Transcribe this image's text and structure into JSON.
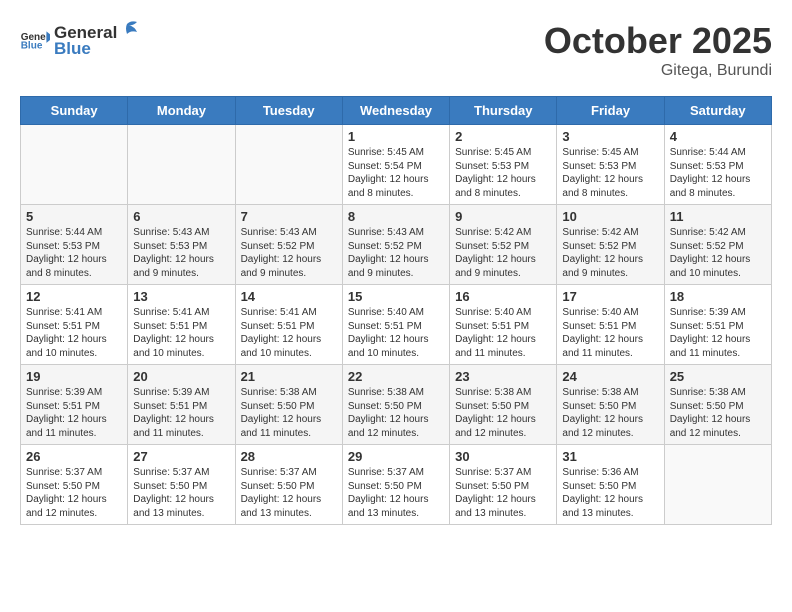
{
  "header": {
    "logo_general": "General",
    "logo_blue": "Blue",
    "month": "October 2025",
    "location": "Gitega, Burundi"
  },
  "days_of_week": [
    "Sunday",
    "Monday",
    "Tuesday",
    "Wednesday",
    "Thursday",
    "Friday",
    "Saturday"
  ],
  "weeks": [
    [
      {
        "day": "",
        "info": ""
      },
      {
        "day": "",
        "info": ""
      },
      {
        "day": "",
        "info": ""
      },
      {
        "day": "1",
        "info": "Sunrise: 5:45 AM\nSunset: 5:54 PM\nDaylight: 12 hours\nand 8 minutes."
      },
      {
        "day": "2",
        "info": "Sunrise: 5:45 AM\nSunset: 5:53 PM\nDaylight: 12 hours\nand 8 minutes."
      },
      {
        "day": "3",
        "info": "Sunrise: 5:45 AM\nSunset: 5:53 PM\nDaylight: 12 hours\nand 8 minutes."
      },
      {
        "day": "4",
        "info": "Sunrise: 5:44 AM\nSunset: 5:53 PM\nDaylight: 12 hours\nand 8 minutes."
      }
    ],
    [
      {
        "day": "5",
        "info": "Sunrise: 5:44 AM\nSunset: 5:53 PM\nDaylight: 12 hours\nand 8 minutes."
      },
      {
        "day": "6",
        "info": "Sunrise: 5:43 AM\nSunset: 5:53 PM\nDaylight: 12 hours\nand 9 minutes."
      },
      {
        "day": "7",
        "info": "Sunrise: 5:43 AM\nSunset: 5:52 PM\nDaylight: 12 hours\nand 9 minutes."
      },
      {
        "day": "8",
        "info": "Sunrise: 5:43 AM\nSunset: 5:52 PM\nDaylight: 12 hours\nand 9 minutes."
      },
      {
        "day": "9",
        "info": "Sunrise: 5:42 AM\nSunset: 5:52 PM\nDaylight: 12 hours\nand 9 minutes."
      },
      {
        "day": "10",
        "info": "Sunrise: 5:42 AM\nSunset: 5:52 PM\nDaylight: 12 hours\nand 9 minutes."
      },
      {
        "day": "11",
        "info": "Sunrise: 5:42 AM\nSunset: 5:52 PM\nDaylight: 12 hours\nand 10 minutes."
      }
    ],
    [
      {
        "day": "12",
        "info": "Sunrise: 5:41 AM\nSunset: 5:51 PM\nDaylight: 12 hours\nand 10 minutes."
      },
      {
        "day": "13",
        "info": "Sunrise: 5:41 AM\nSunset: 5:51 PM\nDaylight: 12 hours\nand 10 minutes."
      },
      {
        "day": "14",
        "info": "Sunrise: 5:41 AM\nSunset: 5:51 PM\nDaylight: 12 hours\nand 10 minutes."
      },
      {
        "day": "15",
        "info": "Sunrise: 5:40 AM\nSunset: 5:51 PM\nDaylight: 12 hours\nand 10 minutes."
      },
      {
        "day": "16",
        "info": "Sunrise: 5:40 AM\nSunset: 5:51 PM\nDaylight: 12 hours\nand 11 minutes."
      },
      {
        "day": "17",
        "info": "Sunrise: 5:40 AM\nSunset: 5:51 PM\nDaylight: 12 hours\nand 11 minutes."
      },
      {
        "day": "18",
        "info": "Sunrise: 5:39 AM\nSunset: 5:51 PM\nDaylight: 12 hours\nand 11 minutes."
      }
    ],
    [
      {
        "day": "19",
        "info": "Sunrise: 5:39 AM\nSunset: 5:51 PM\nDaylight: 12 hours\nand 11 minutes."
      },
      {
        "day": "20",
        "info": "Sunrise: 5:39 AM\nSunset: 5:51 PM\nDaylight: 12 hours\nand 11 minutes."
      },
      {
        "day": "21",
        "info": "Sunrise: 5:38 AM\nSunset: 5:50 PM\nDaylight: 12 hours\nand 11 minutes."
      },
      {
        "day": "22",
        "info": "Sunrise: 5:38 AM\nSunset: 5:50 PM\nDaylight: 12 hours\nand 12 minutes."
      },
      {
        "day": "23",
        "info": "Sunrise: 5:38 AM\nSunset: 5:50 PM\nDaylight: 12 hours\nand 12 minutes."
      },
      {
        "day": "24",
        "info": "Sunrise: 5:38 AM\nSunset: 5:50 PM\nDaylight: 12 hours\nand 12 minutes."
      },
      {
        "day": "25",
        "info": "Sunrise: 5:38 AM\nSunset: 5:50 PM\nDaylight: 12 hours\nand 12 minutes."
      }
    ],
    [
      {
        "day": "26",
        "info": "Sunrise: 5:37 AM\nSunset: 5:50 PM\nDaylight: 12 hours\nand 12 minutes."
      },
      {
        "day": "27",
        "info": "Sunrise: 5:37 AM\nSunset: 5:50 PM\nDaylight: 12 hours\nand 13 minutes."
      },
      {
        "day": "28",
        "info": "Sunrise: 5:37 AM\nSunset: 5:50 PM\nDaylight: 12 hours\nand 13 minutes."
      },
      {
        "day": "29",
        "info": "Sunrise: 5:37 AM\nSunset: 5:50 PM\nDaylight: 12 hours\nand 13 minutes."
      },
      {
        "day": "30",
        "info": "Sunrise: 5:37 AM\nSunset: 5:50 PM\nDaylight: 12 hours\nand 13 minutes."
      },
      {
        "day": "31",
        "info": "Sunrise: 5:36 AM\nSunset: 5:50 PM\nDaylight: 12 hours\nand 13 minutes."
      },
      {
        "day": "",
        "info": ""
      }
    ]
  ]
}
